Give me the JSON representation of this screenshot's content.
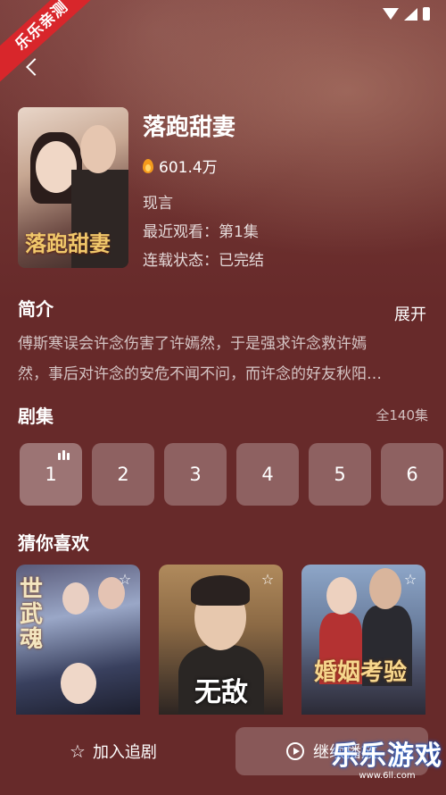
{
  "badge": "乐乐亲测",
  "drama": {
    "title": "落跑甜妻",
    "poster_title": "落跑甜妻",
    "heat": "601.4万",
    "genre": "现言",
    "recent_watch": "最近观看：第1集",
    "status": "连载状态：已完结"
  },
  "intro": {
    "heading": "简介",
    "expand_label": "展开",
    "lines": [
      "傅斯寒误会许念伤害了许嫣然，于是强求许念救许嫣",
      "然，事后对许念的安危不闻不问，而许念的好友秋阳…"
    ]
  },
  "episodes": {
    "heading": "剧集",
    "total": "全140集",
    "items": [
      "1",
      "2",
      "3",
      "4",
      "5",
      "6"
    ],
    "current": "1"
  },
  "recommend": {
    "heading": "猜你喜欢",
    "items": [
      {
        "poster_title": "世武魂"
      },
      {
        "poster_title": "无敌"
      },
      {
        "poster_title": "婚姻考验"
      }
    ]
  },
  "actions": {
    "follow_label": "加入追剧",
    "play_label": "继续播放"
  },
  "watermark": {
    "main": "乐乐游戏",
    "url": "www.6ll.com"
  },
  "colors": {
    "background": "#672a2a",
    "badge": "#d8262b",
    "heat_icon": "#f59b1c"
  }
}
